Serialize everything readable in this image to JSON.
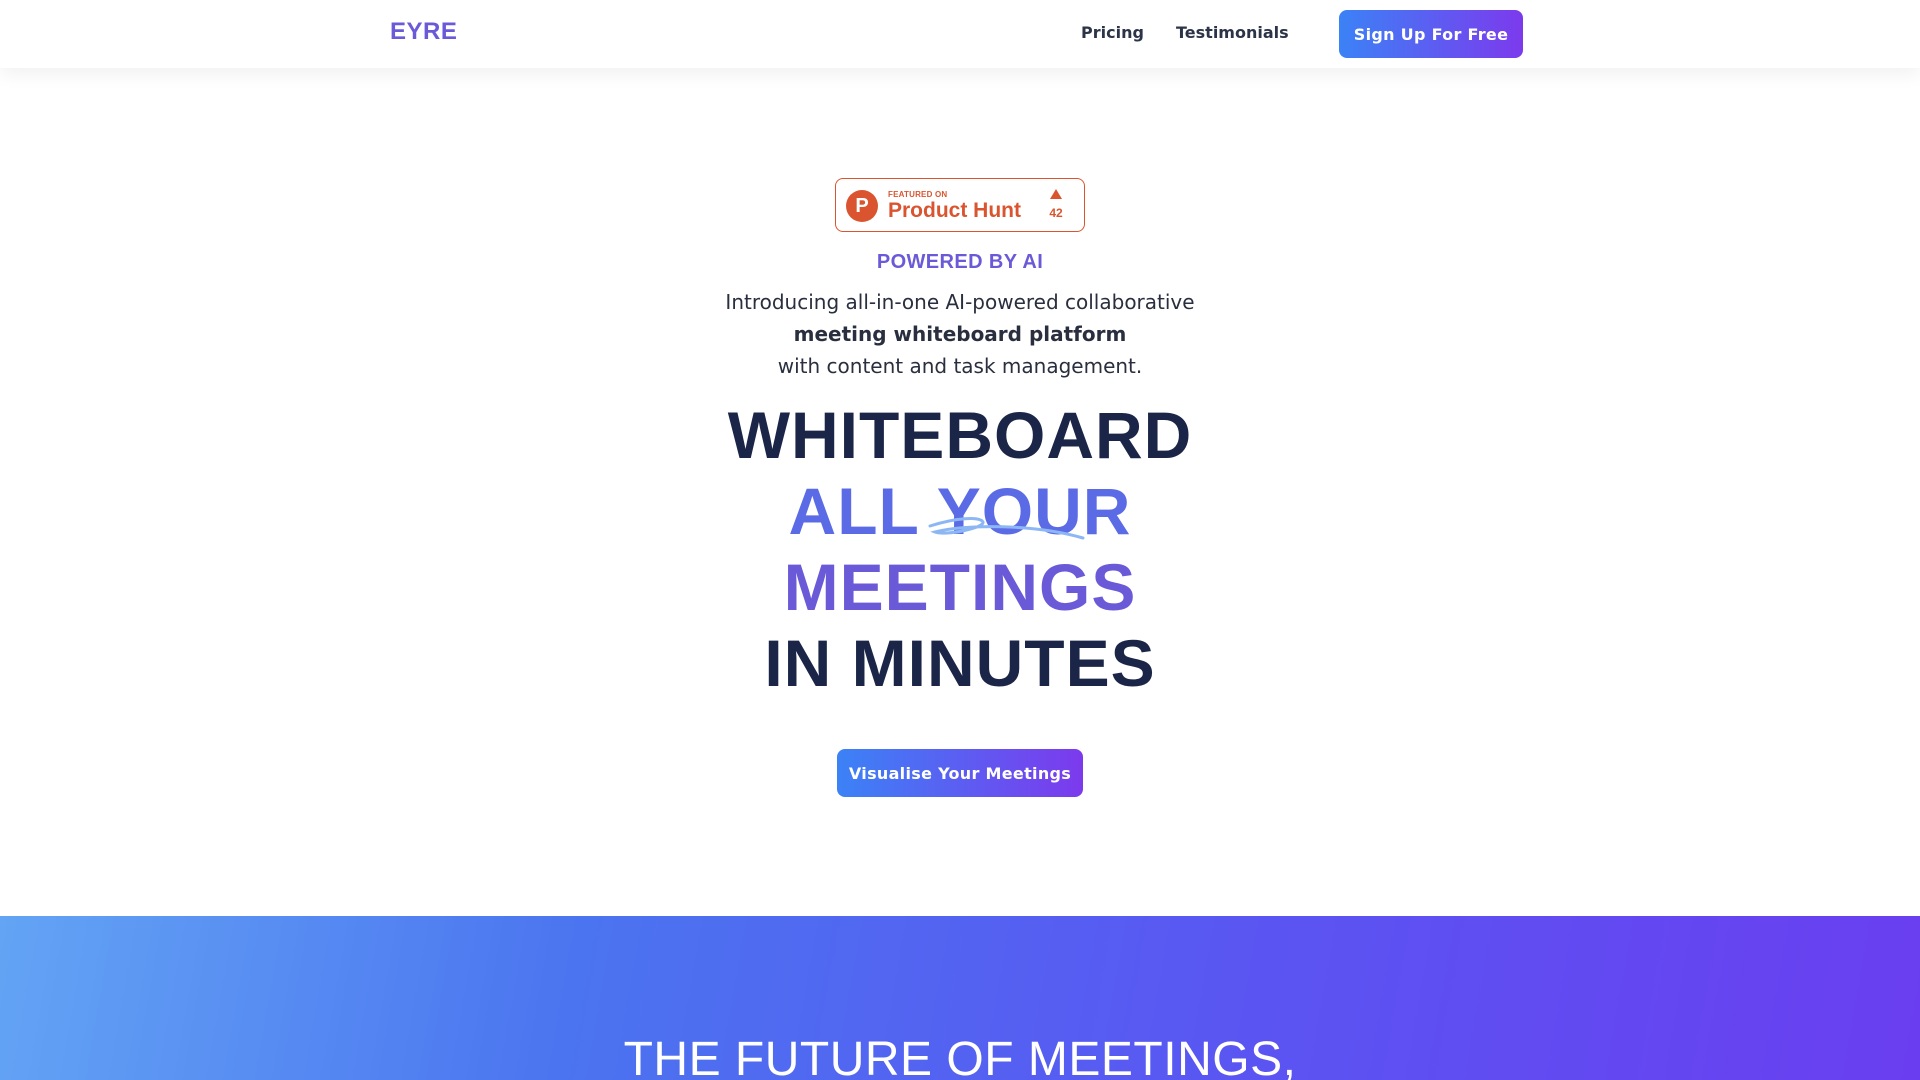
{
  "nav": {
    "logo": "EYRE",
    "links": [
      "Pricing",
      "Testimonials"
    ],
    "cta": "Sign Up For Free"
  },
  "badge": {
    "featured": "FEATURED ON",
    "name": "Product Hunt",
    "logo_letter": "P",
    "count": "42"
  },
  "hero": {
    "eyebrow": "POWERED BY AI",
    "intro_line1": "Introducing all-in-one AI-powered collaborative",
    "intro_line2": "meeting whiteboard platform",
    "intro_line3": "with content and task management.",
    "heading_line1": "WHITEBOARD",
    "heading_line2": "ALL YOUR",
    "heading_line3": "MEETINGS",
    "heading_line4": "IN MINUTES",
    "cta": "Visualise Your Meetings"
  },
  "section": {
    "title": "THE FUTURE OF MEETINGS,"
  },
  "colors": {
    "brand": "#6b5ad8",
    "heading_dark": "#1b2547",
    "gradient_start": "#3b82f6",
    "gradient_end": "#7c3aed",
    "product_hunt": "#da552f"
  }
}
